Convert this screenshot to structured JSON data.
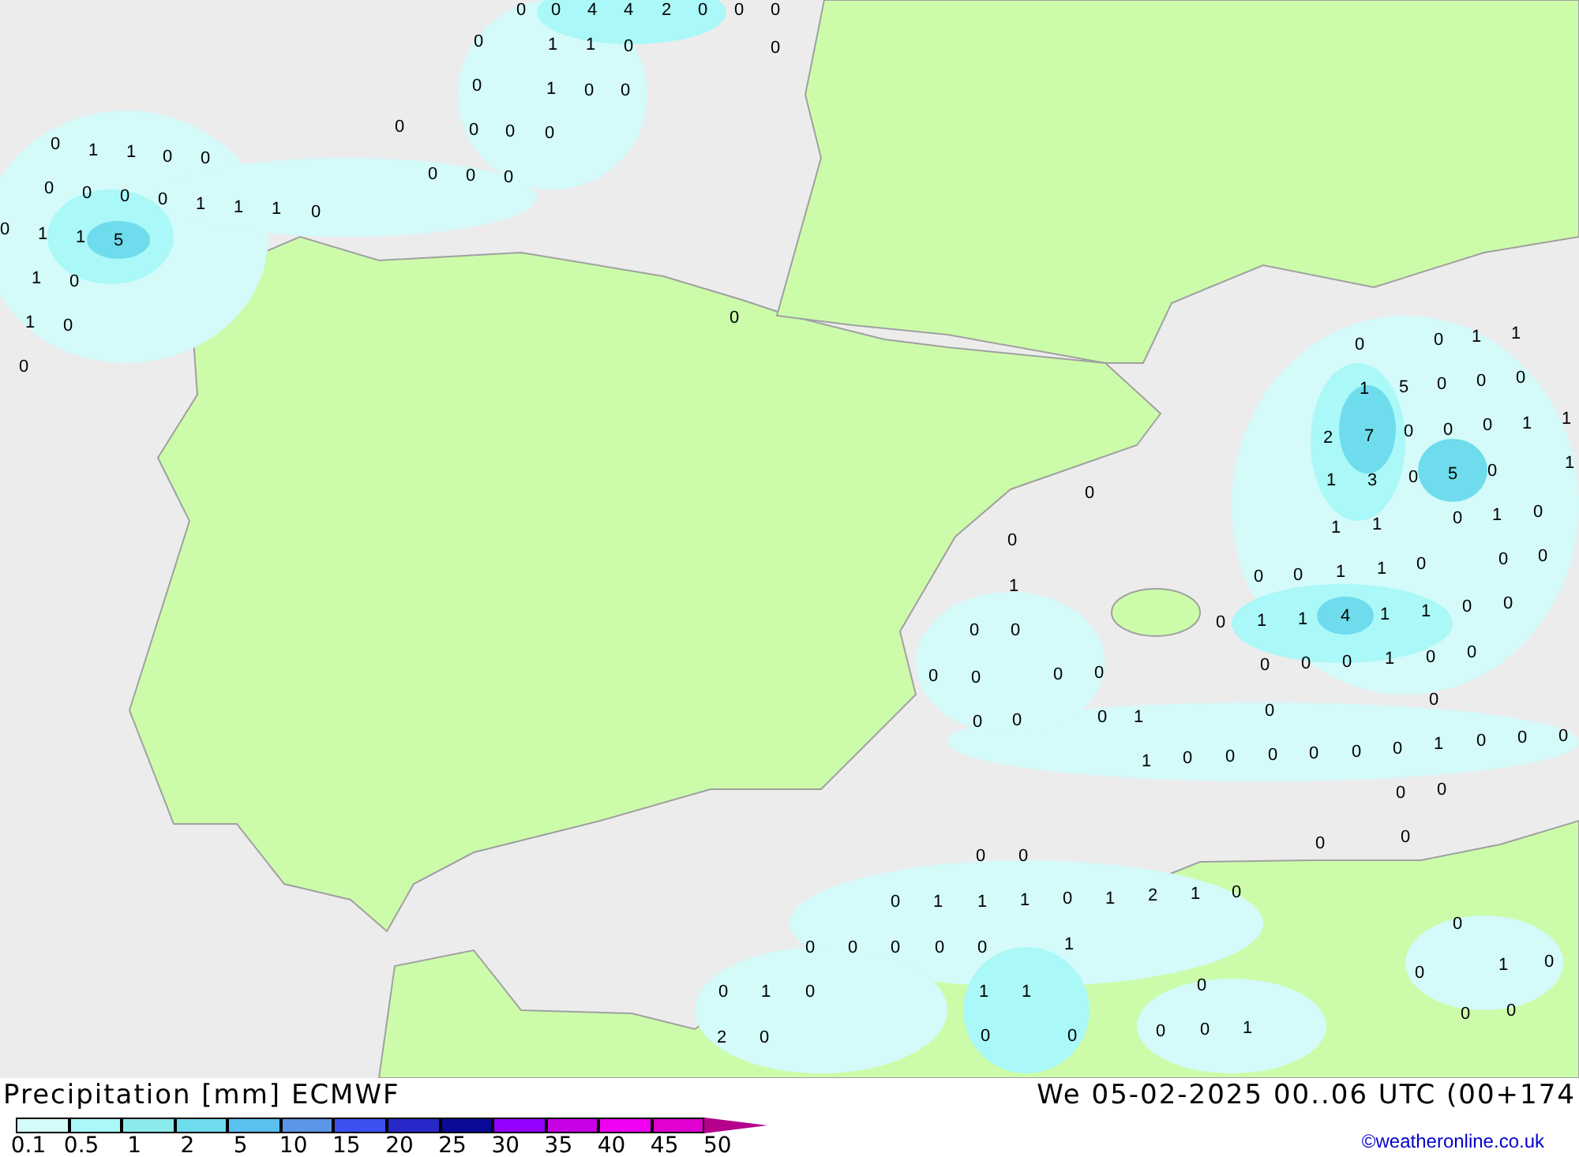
{
  "map": {
    "values": [
      "0",
      "0",
      "4",
      "4",
      "2",
      "0",
      "0",
      "0",
      "0",
      "1",
      "1",
      "0",
      "0",
      "0",
      "1",
      "0",
      "0",
      "0",
      "0",
      "0",
      "0",
      "0",
      "1",
      "1",
      "0",
      "0",
      "0",
      "0",
      "0",
      "0",
      "0",
      "0",
      "0",
      "1",
      "1",
      "1",
      "0",
      "0",
      "1",
      "1",
      "5",
      "1",
      "0",
      "1",
      "0",
      "0",
      "0",
      "0",
      "0",
      "1",
      "1",
      "1",
      "5",
      "0",
      "0",
      "0",
      "2",
      "7",
      "0",
      "0",
      "0",
      "1",
      "1",
      "1",
      "3",
      "0",
      "5",
      "0",
      "1",
      "1",
      "1",
      "0",
      "1",
      "0",
      "0",
      "0",
      "0",
      "0",
      "1",
      "1",
      "0",
      "0",
      "1",
      "1",
      "4",
      "1",
      "1",
      "0",
      "0",
      "0",
      "0",
      "0",
      "1",
      "0",
      "0",
      "0",
      "0",
      "1",
      "0",
      "0",
      "0",
      "0",
      "0",
      "0",
      "0",
      "0",
      "0",
      "1",
      "0",
      "0",
      "1",
      "0",
      "0",
      "0",
      "0",
      "0",
      "0",
      "1",
      "0",
      "0",
      "0",
      "0",
      "0",
      "0",
      "0",
      "0",
      "0",
      "0",
      "1",
      "1",
      "1",
      "0",
      "1",
      "2",
      "1",
      "0",
      "0",
      "0",
      "0",
      "0",
      "0",
      "1",
      "0",
      "1",
      "0",
      "1",
      "1",
      "2",
      "0",
      "0",
      "0",
      "0",
      "0",
      "0",
      "1",
      "0",
      "0",
      "1",
      "0",
      "0",
      "0"
    ]
  },
  "footer": {
    "title": "Precipitation [mm] ECMWF",
    "datetime": "We 05-02-2025 00..06 UTC (00+174",
    "scale": [
      {
        "label": "0.1",
        "color": "#d4fafa"
      },
      {
        "label": "0.5",
        "color": "#aaf8f8"
      },
      {
        "label": "1",
        "color": "#8ceaea"
      },
      {
        "label": "2",
        "color": "#6edcec"
      },
      {
        "label": "5",
        "color": "#5ac0f0"
      },
      {
        "label": "10",
        "color": "#5a96e6"
      },
      {
        "label": "15",
        "color": "#3c50ef"
      },
      {
        "label": "20",
        "color": "#2828c8"
      },
      {
        "label": "25",
        "color": "#0a0a96"
      },
      {
        "label": "30",
        "color": "#9600ff"
      },
      {
        "label": "35",
        "color": "#c800e6"
      },
      {
        "label": "40",
        "color": "#f000f0"
      },
      {
        "label": "45",
        "color": "#e000d0"
      },
      {
        "label": "50",
        "color": "#b4008c"
      }
    ],
    "credit": "©weatheronline.co.uk"
  }
}
